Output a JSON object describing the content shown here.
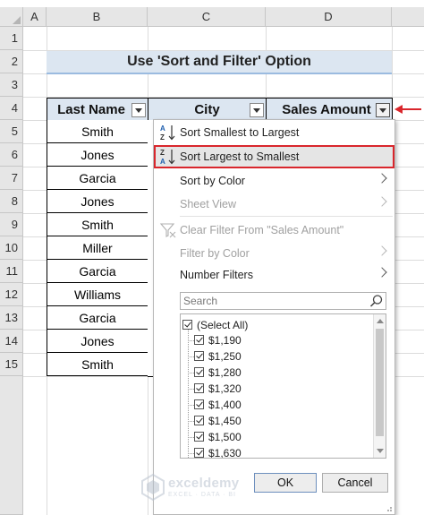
{
  "columns": [
    "A",
    "B",
    "C",
    "D"
  ],
  "rows": [
    "1",
    "2",
    "3",
    "4",
    "5",
    "6",
    "7",
    "8",
    "9",
    "10",
    "11",
    "12",
    "13",
    "14",
    "15"
  ],
  "title": "Use 'Sort and Filter' Option",
  "table": {
    "headers": [
      "Last Name",
      "City",
      "Sales Amount"
    ],
    "last_names": [
      "Smith",
      "Jones",
      "Garcia",
      "Jones",
      "Smith",
      "Miller",
      "Garcia",
      "Williams",
      "Garcia",
      "Jones",
      "Smith"
    ]
  },
  "menu": {
    "sort_asc": "Sort Smallest to Largest",
    "sort_desc": "Sort Largest to Smallest",
    "sort_by_color": "Sort by Color",
    "sheet_view": "Sheet View",
    "clear_filter": "Clear Filter From \"Sales Amount\"",
    "filter_by_color": "Filter by Color",
    "number_filters": "Number Filters",
    "search_placeholder": "Search",
    "list": [
      "(Select All)",
      "$1,190",
      "$1,250",
      "$1,280",
      "$1,320",
      "$1,400",
      "$1,450",
      "$1,500",
      "$1,630"
    ],
    "ok": "OK",
    "cancel": "Cancel"
  },
  "watermark": {
    "name": "exceldemy",
    "tagline": "EXCEL · DATA · BI"
  },
  "colors": {
    "accent_red": "#d9262c",
    "header_fill": "#dce6f1"
  }
}
